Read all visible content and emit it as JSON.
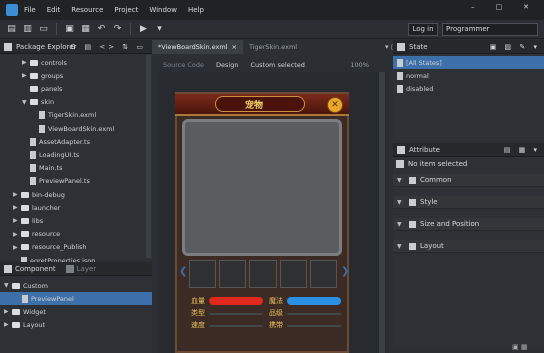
{
  "menu": [
    "File",
    "Edit",
    "Resource",
    "Project",
    "Window",
    "Help"
  ],
  "toolbar": {
    "login_label": "Log in",
    "mode_value": "Programmer"
  },
  "package_explorer": {
    "title": "Package Explorer",
    "items": [
      {
        "label": "controls",
        "type": "folder",
        "indent": 2,
        "arrow": "▶"
      },
      {
        "label": "groups",
        "type": "folder",
        "indent": 2,
        "arrow": "▶"
      },
      {
        "label": "panels",
        "type": "folder",
        "indent": 2,
        "arrow": ""
      },
      {
        "label": "skin",
        "type": "folder",
        "indent": 2,
        "arrow": "▼"
      },
      {
        "label": "TigerSkin.exml",
        "type": "file",
        "indent": 3,
        "arrow": ""
      },
      {
        "label": "ViewBoardSkin.exml",
        "type": "file",
        "indent": 3,
        "arrow": ""
      },
      {
        "label": "AssetAdapter.ts",
        "type": "file",
        "indent": 2,
        "arrow": ""
      },
      {
        "label": "LoadingUI.ts",
        "type": "file",
        "indent": 2,
        "arrow": ""
      },
      {
        "label": "Main.ts",
        "type": "file",
        "indent": 2,
        "arrow": ""
      },
      {
        "label": "PreviewPanel.ts",
        "type": "file",
        "indent": 2,
        "arrow": ""
      },
      {
        "label": "bin-debug",
        "type": "folder",
        "indent": 1,
        "arrow": "▶"
      },
      {
        "label": "launcher",
        "type": "folder",
        "indent": 1,
        "arrow": "▶"
      },
      {
        "label": "libs",
        "type": "folder",
        "indent": 1,
        "arrow": "▶"
      },
      {
        "label": "resource",
        "type": "folder",
        "indent": 1,
        "arrow": "▶"
      },
      {
        "label": "resource_Publish",
        "type": "folder",
        "indent": 1,
        "arrow": "▶"
      },
      {
        "label": "egretProperties.json",
        "type": "file",
        "indent": 1,
        "arrow": ""
      }
    ]
  },
  "component_panel": {
    "tabs": [
      "Component",
      "Layer"
    ],
    "items": [
      {
        "label": "Custom",
        "indent": 0,
        "arrow": "▼",
        "selected": false
      },
      {
        "label": "PreviewPanel",
        "indent": 1,
        "arrow": "",
        "selected": true
      },
      {
        "label": "Widget",
        "indent": 0,
        "arrow": "▶",
        "selected": false
      },
      {
        "label": "Layout",
        "indent": 0,
        "arrow": "▶",
        "selected": false
      }
    ]
  },
  "editor": {
    "tabs": [
      "*ViewBoardSkin.exml",
      "TigerSkin.exml"
    ],
    "subtabs": [
      "Source Code",
      "Design"
    ],
    "mode_value": "Custom selected",
    "zoom": "100%",
    "title_text": "宠物",
    "stats": [
      {
        "label": "血量",
        "bar_color": "#e0281e"
      },
      {
        "label": "魔法",
        "bar_color": "#2c8fe6"
      },
      {
        "label": "类型",
        "bar_color": ""
      },
      {
        "label": "品级",
        "bar_color": ""
      },
      {
        "label": "速度",
        "bar_color": ""
      },
      {
        "label": "携带",
        "bar_color": ""
      }
    ]
  },
  "state_panel": {
    "title": "State",
    "items": [
      {
        "label": "[All States]",
        "selected": true
      },
      {
        "label": "normal",
        "selected": false
      },
      {
        "label": "disabled",
        "selected": false
      }
    ]
  },
  "attribute_panel": {
    "title": "Attribute",
    "status": "No item selected",
    "sections": [
      "Common",
      "Style",
      "Size and Position",
      "Layout"
    ]
  }
}
